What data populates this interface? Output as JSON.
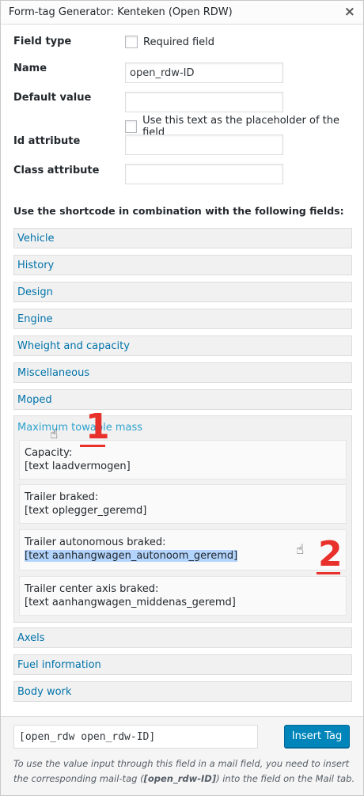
{
  "dialog": {
    "title": "Form-tag Generator: Kenteken (Open RDW)",
    "close_icon": "×"
  },
  "form": {
    "field_type_label": "Field type",
    "required_label": "Required field",
    "name_label": "Name",
    "name_value": "open_rdw-ID",
    "default_value_label": "Default value",
    "default_value": "",
    "placeholder_label": "Use this text as the placeholder of the field",
    "id_attr_label": "Id attribute",
    "id_attr_value": "",
    "class_attr_label": "Class attribute",
    "class_attr_value": ""
  },
  "shortcode": {
    "heading": "Use the shortcode in combination with the following fields:",
    "sections": [
      "Vehicle",
      "History",
      "Design",
      "Engine",
      "Wheight and capacity",
      "Miscellaneous",
      "Moped"
    ],
    "open_section": {
      "label": "Maximum towable mass",
      "fields": [
        {
          "label": "Capacity:",
          "code": "[text laadvermogen]"
        },
        {
          "label": "Trailer braked:",
          "code": "[text oplegger_geremd]"
        },
        {
          "label": "Trailer autonomous braked:",
          "code": "[text aanhangwagen_autonoom_geremd]"
        },
        {
          "label": "Trailer center axis braked:",
          "code": "[text aanhangwagen_middenas_geremd]"
        }
      ]
    },
    "sections_after": [
      "Axels",
      "Fuel information",
      "Body work"
    ]
  },
  "annotations": {
    "marker_1": "1",
    "marker_2": "2",
    "color": "#e8312a"
  },
  "footer": {
    "tag_value": "[open_rdw open_rdw-ID]",
    "insert_label": "Insert Tag",
    "hint_part1": "To use the value input through this field in a mail field, you need to insert the corresponding mail-tag (",
    "hint_tag": "[open_rdw-ID]",
    "hint_part2": ") into the field on the Mail tab."
  },
  "colors": {
    "link": "#0073aa",
    "button": "#0085ba",
    "selection": "#b3d4fc"
  }
}
